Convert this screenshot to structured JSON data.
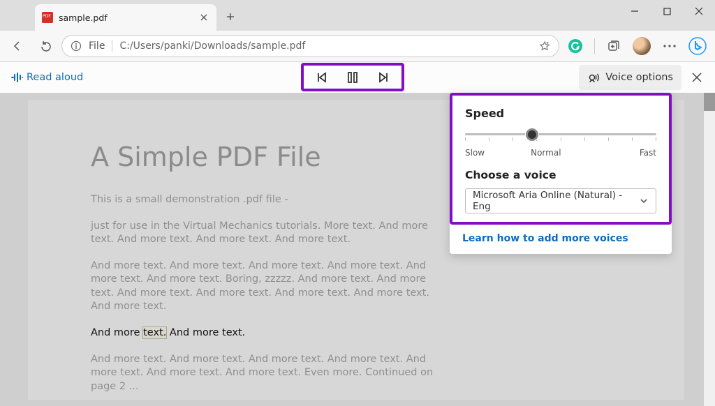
{
  "tab": {
    "title": "sample.pdf"
  },
  "address": {
    "scheme_label": "File",
    "url": "C:/Users/panki/Downloads/sample.pdf"
  },
  "read_aloud": {
    "label": "Read aloud",
    "voice_options_label": "Voice options"
  },
  "voice_panel": {
    "speed_label": "Speed",
    "slow": "Slow",
    "normal": "Normal",
    "fast": "Fast",
    "choose_label": "Choose a voice",
    "selected_voice": "Microsoft Aria Online (Natural) - Eng",
    "learn_link": "Learn how to add more voices"
  },
  "pdf": {
    "h1": "A Simple PDF File",
    "p1": "This is a small demonstration .pdf file -",
    "p2": "just for use in the Virtual Mechanics tutorials. More text. And more text. And more text. And more text. And more text.",
    "p3": "And more text. And more text. And more text. And more text. And more text. And more text. Boring, zzzzz. And more text. And more text. And more text. And more text. And more text. And more text. And more text.",
    "active_pre": "And more ",
    "active_hl": "text.",
    "active_post": " And more text.",
    "p5": "And more text. And more text. And more text. And more text. And more text. And more text. And more text. Even more. Continued on page 2 ..."
  }
}
